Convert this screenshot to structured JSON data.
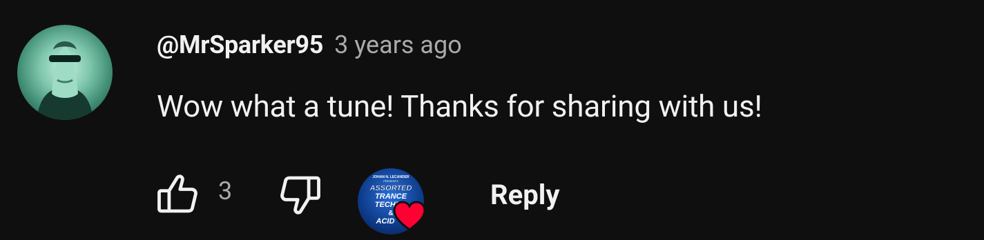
{
  "comment": {
    "author": "@MrSparker95",
    "time": "3 years ago",
    "text": "Wow what a tune! Thanks for sharing with us!",
    "avatar_icon": "user-avatar"
  },
  "actions": {
    "like_icon": "thumbs-up-icon",
    "like_count": "3",
    "dislike_icon": "thumbs-down-icon",
    "creator_heart": {
      "avatar_icon": "creator-avatar",
      "avatar_text": [
        "JOHAN N. LECANDER",
        "PRESENTS",
        "ASSORTED",
        "TRANCE",
        "TECHNO",
        "&",
        "ACID"
      ],
      "heart_icon": "heart-icon",
      "heart_color": "#ff0033"
    },
    "reply_label": "Reply"
  },
  "colors": {
    "background": "#0f0f0f",
    "primary_text": "#f1f1f1",
    "secondary_text": "#aaaaaa"
  }
}
